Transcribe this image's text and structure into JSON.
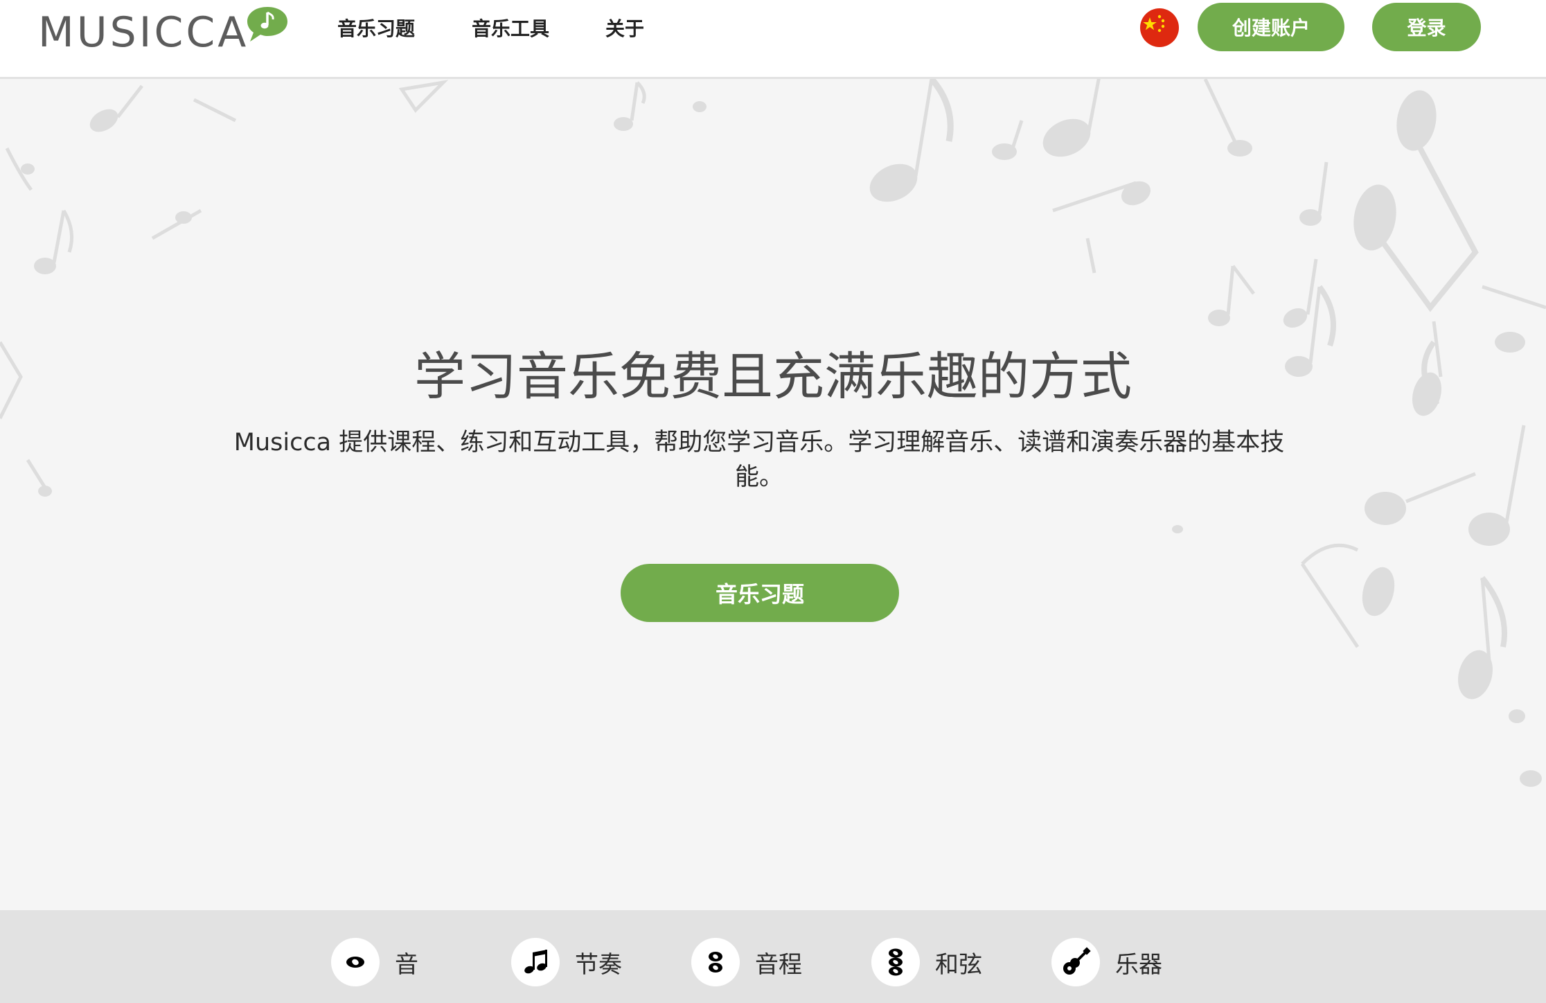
{
  "brand": {
    "name": "MUSICCA"
  },
  "nav": {
    "items": [
      {
        "label": "音乐习题"
      },
      {
        "label": "音乐工具"
      },
      {
        "label": "关于"
      }
    ]
  },
  "header": {
    "language_flag": "china-flag-icon",
    "create_account_label": "创建账户",
    "login_label": "登录"
  },
  "hero": {
    "title": "学习音乐免费且充满乐趣的方式",
    "description": "Musicca 提供课程、练习和互动工具，帮助您学习音乐。学习理解音乐、读谱和演奏乐器的基本技能。",
    "cta_label": "音乐习题"
  },
  "categories": [
    {
      "label": "音",
      "icon": "whole-note-icon"
    },
    {
      "label": "节奏",
      "icon": "eighth-notes-icon"
    },
    {
      "label": "音程",
      "icon": "interval-icon"
    },
    {
      "label": "和弦",
      "icon": "chord-icon"
    },
    {
      "label": "乐器",
      "icon": "guitar-icon"
    }
  ],
  "colors": {
    "accent": "#72ac4c",
    "hero_background": "#f5f5f5",
    "category_bar": "#e2e2e2",
    "flag_red": "#de2910",
    "flag_yellow": "#ffde00"
  }
}
